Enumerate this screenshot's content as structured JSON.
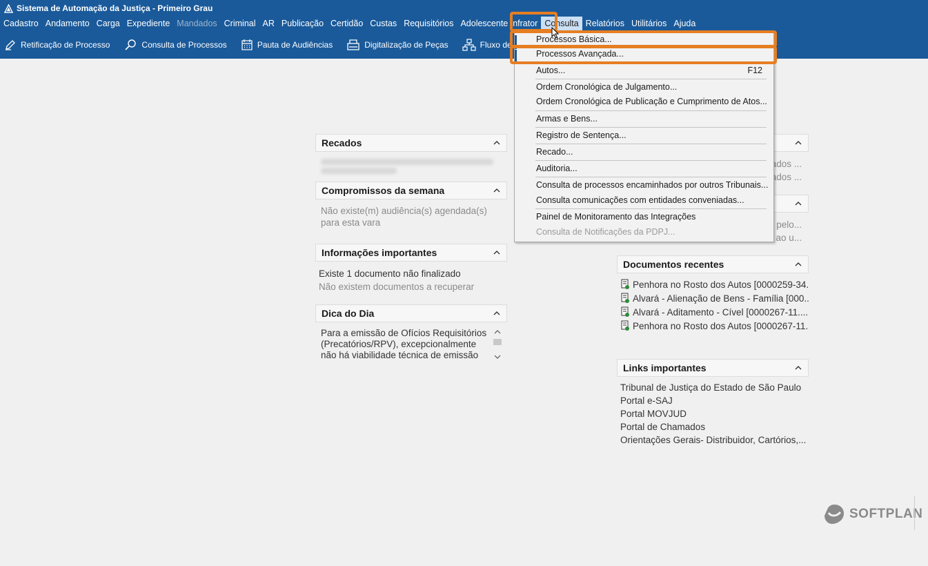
{
  "window": {
    "title": "Sistema de Automação da Justiça - Primeiro Grau"
  },
  "menubar": {
    "items": [
      {
        "label": "Cadastro",
        "disabled": false
      },
      {
        "label": "Andamento",
        "disabled": false
      },
      {
        "label": "Carga",
        "disabled": false
      },
      {
        "label": "Expediente",
        "disabled": false
      },
      {
        "label": "Mandados",
        "disabled": true
      },
      {
        "label": "Criminal",
        "disabled": false
      },
      {
        "label": "AR",
        "disabled": false
      },
      {
        "label": "Publicação",
        "disabled": false
      },
      {
        "label": "Certidão",
        "disabled": false
      },
      {
        "label": "Custas",
        "disabled": false
      },
      {
        "label": "Requisitórios",
        "disabled": false
      },
      {
        "label": "Adolescente Infrator",
        "disabled": false
      },
      {
        "label": "Consulta",
        "disabled": false,
        "active": true
      },
      {
        "label": "Relatórios",
        "disabled": false
      },
      {
        "label": "Utilitários",
        "disabled": false
      },
      {
        "label": "Ajuda",
        "disabled": false
      }
    ]
  },
  "toolbar": {
    "items": [
      {
        "label": "Retificação de Processo",
        "icon": "pencil-icon"
      },
      {
        "label": "Consulta de Processos",
        "icon": "search-icon"
      },
      {
        "label": "Pauta de Audiências",
        "icon": "calendar-icon"
      },
      {
        "label": "Digitalização de Peças",
        "icon": "scanner-icon"
      },
      {
        "label": "Fluxo de Trabalho",
        "icon": "workflow-icon"
      }
    ]
  },
  "consulta_menu": {
    "items": [
      {
        "label": "Processos Básica...",
        "shortcut": "",
        "disabled": false,
        "highlighted": true
      },
      {
        "label": "Processos Avançada...",
        "shortcut": "",
        "disabled": false,
        "highlighted": true
      },
      {
        "label": "Autos...",
        "shortcut": "F12",
        "disabled": false
      },
      {
        "label": "Ordem Cronológica de Julgamento...",
        "shortcut": "",
        "disabled": false
      },
      {
        "label": "Ordem Cronológica de Publicação e Cumprimento de Atos...",
        "shortcut": "",
        "disabled": false
      },
      {
        "label": "Armas e Bens...",
        "shortcut": "",
        "disabled": false
      },
      {
        "label": "Registro de Sentença...",
        "shortcut": "",
        "disabled": false
      },
      {
        "label": "Recado...",
        "shortcut": "",
        "disabled": false
      },
      {
        "label": "Auditoria...",
        "shortcut": "",
        "disabled": false
      },
      {
        "label": "Consulta de processos encaminhados por outros Tribunais...",
        "shortcut": "",
        "disabled": false
      },
      {
        "label": "Consulta comunicações com entidades conveniadas...",
        "shortcut": "",
        "disabled": false
      },
      {
        "label": "Painel de Monitoramento das Integrações",
        "shortcut": "",
        "disabled": false
      },
      {
        "label": "Consulta de Notificações da PDPJ...",
        "shortcut": "",
        "disabled": true
      }
    ]
  },
  "panels": {
    "recados": {
      "title": "Recados"
    },
    "compromissos": {
      "title": "Compromissos da semana",
      "text_line1": "Não existe(m) audiência(s) agendada(s)",
      "text_line2": "para esta vara"
    },
    "informacoes": {
      "title": "Informações importantes",
      "line1": "Existe 1 documento não finalizado",
      "line2": "Não existem documentos a recuperar"
    },
    "dica": {
      "title": "Dica do Dia",
      "line1": "Para a emissão de Ofícios Requisitórios",
      "line2": "(Precatórios/RPV), excepcionalmente",
      "line3": "não há viabilidade técnica de emissão"
    },
    "right_partial_1": {
      "line1": "ados ...",
      "line2": "ados ..."
    },
    "right_partial_2": {
      "line1": "s pelo...",
      "line2": "s ao u..."
    },
    "documentos": {
      "title": "Documentos recentes",
      "items": [
        "Penhora no Rosto dos Autos [0000259-34...",
        "Alvará - Alienação de Bens - Família [000...",
        "Alvará - Aditamento - Cível [0000267-11....",
        "Penhora no Rosto dos Autos [0000267-11..."
      ]
    },
    "links": {
      "title": "Links importantes",
      "items": [
        "Tribunal de Justiça do Estado de São Paulo",
        "Portal e-SAJ",
        "Portal MOVJUD",
        "Portal de Chamados",
        "Orientações Gerais- Distribuidor, Cartórios,..."
      ]
    }
  },
  "branding": {
    "logo_text": "SOFTPLAN"
  },
  "colors": {
    "header_blue": "#1a5a9a",
    "highlight_orange": "#e67e22"
  }
}
